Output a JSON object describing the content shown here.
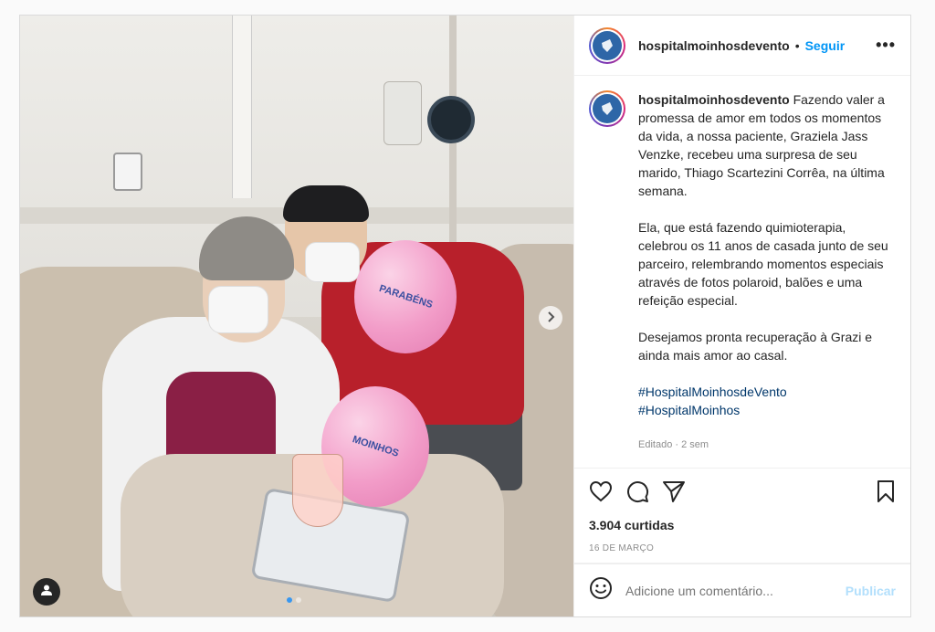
{
  "post": {
    "username": "hospitalmoinhosdevento",
    "follow_label": "Seguir",
    "separator": "•",
    "more_label": "•••",
    "caption": {
      "paragraph1": "Fazendo valer a promessa de amor em todos os momentos da vida, a nossa paciente, Graziela Jass Venzke, recebeu uma surpresa de seu marido, Thiago Scartezini Corrêa, na última semana.",
      "paragraph2": "Ela, que está fazendo quimioterapia, celebrou os 11 anos de casada junto de seu parceiro, relembrando momentos especiais através de fotos polaroid, balões e uma refeição especial.",
      "paragraph3": "Desejamos pronta recuperação à Grazi e ainda mais amor ao casal.",
      "hashtags": [
        "#HospitalMoinhosdeVento",
        "#HospitalMoinhos"
      ],
      "edited": "Editado · 2 sem"
    },
    "likes": "3.904 curtidas",
    "date": "16 DE MARÇO",
    "comment_placeholder": "Adicione um comentário...",
    "publish_label": "Publicar",
    "icons": {
      "like": "heart-icon",
      "comment": "comment-icon",
      "share": "paper-plane-icon",
      "save": "bookmark-icon",
      "emoji": "smiley-icon",
      "next": "chevron-right-icon",
      "tag": "user-tag-icon"
    },
    "photo": {
      "balloon_text_1": "PARABÉNS",
      "balloon_text_2": "MOINHOS"
    },
    "carousel": {
      "slides": 2,
      "active": 1
    },
    "colors": {
      "link": "#0095f6",
      "hashtag": "#00376b",
      "publish": "#b2dffc"
    }
  }
}
